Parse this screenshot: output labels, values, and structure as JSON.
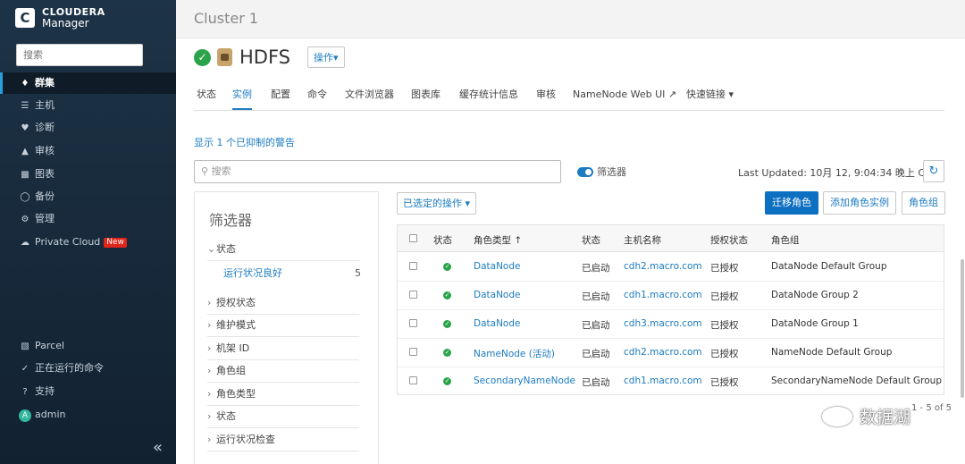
{
  "sidebar": {
    "logo_line1": "CLOUDERA",
    "logo_line2": "Manager",
    "search_placeholder": "搜索",
    "items": [
      {
        "label": "群集",
        "icon": "clusters-icon",
        "active": true
      },
      {
        "label": "主机",
        "icon": "hosts-icon"
      },
      {
        "label": "诊断",
        "icon": "diagnostics-icon"
      },
      {
        "label": "审核",
        "icon": "audit-icon"
      },
      {
        "label": "图表",
        "icon": "charts-icon"
      },
      {
        "label": "备份",
        "icon": "backup-icon"
      },
      {
        "label": "管理",
        "icon": "admin-gear-icon"
      },
      {
        "label": "Private Cloud",
        "icon": "cloud-icon",
        "badge": "New"
      }
    ],
    "bottom_items": [
      {
        "label": "Parcel",
        "icon": "parcel-icon"
      },
      {
        "label": "正在运行的命令",
        "icon": "running-commands-icon"
      },
      {
        "label": "支持",
        "icon": "help-icon"
      },
      {
        "label": "admin",
        "icon": "user-avatar-icon",
        "avatar_letter": "A"
      }
    ],
    "collapse_glyph": "«"
  },
  "header": {
    "cluster_title": "Cluster 1",
    "service_name": "HDFS",
    "actions_label": "操作▾"
  },
  "tabs": [
    {
      "label": "状态"
    },
    {
      "label": "实例",
      "active": true
    },
    {
      "label": "配置"
    },
    {
      "label": "命令"
    },
    {
      "label": "文件浏览器"
    },
    {
      "label": "图表库"
    },
    {
      "label": "缓存统计信息"
    },
    {
      "label": "审核"
    },
    {
      "label": "NameNode Web UI ↗"
    },
    {
      "label": "快速链接 ▾"
    }
  ],
  "suppressed_warning": "显示 1 个已抑制的警告",
  "search_placeholder": "搜索",
  "filter_toggle_label": "筛选器",
  "last_updated": "Last Updated: 10月 12, 9:04:34 晚上 CST",
  "filter_panel": {
    "title": "筛选器",
    "expanded_section": "状态",
    "sub_item": {
      "label": "运行状况良好",
      "count": "5"
    },
    "sections": [
      "授权状态",
      "维护模式",
      "机架 ID",
      "角色组",
      "角色类型",
      "状态",
      "运行状况检查"
    ]
  },
  "buttons": {
    "selected_actions": "已选定的操作 ▾",
    "migrate_roles": "迁移角色",
    "add_role_instances": "添加角色实例",
    "role_groups": "角色组"
  },
  "table": {
    "headers": [
      "状态",
      "角色类型 ↑",
      "状态",
      "主机名称",
      "授权状态",
      "角色组"
    ],
    "rows": [
      {
        "role_type": "DataNode",
        "state": "已启动",
        "host": "cdh2.macro.com",
        "commission": "已授权",
        "group": "DataNode Default Group"
      },
      {
        "role_type": "DataNode",
        "state": "已启动",
        "host": "cdh1.macro.com",
        "commission": "已授权",
        "group": "DataNode Group 2"
      },
      {
        "role_type": "DataNode",
        "state": "已启动",
        "host": "cdh3.macro.com",
        "commission": "已授权",
        "group": "DataNode Group 1"
      },
      {
        "role_type": "NameNode (活动)",
        "state": "已启动",
        "host": "cdh2.macro.com",
        "commission": "已授权",
        "group": "NameNode Default Group"
      },
      {
        "role_type": "SecondaryNameNode",
        "state": "已启动",
        "host": "cdh1.macro.com",
        "commission": "已授权",
        "group": "SecondaryNameNode Default Group"
      }
    ]
  },
  "pager": "1 - 5 of 5",
  "watermark": "数据湖",
  "colors": {
    "sidebar_bg": "#1d3347",
    "accent": "#1c7bc1",
    "primary_button": "#0d6fc2",
    "status_ok": "#2aa34a",
    "new_badge": "#e0261b"
  }
}
